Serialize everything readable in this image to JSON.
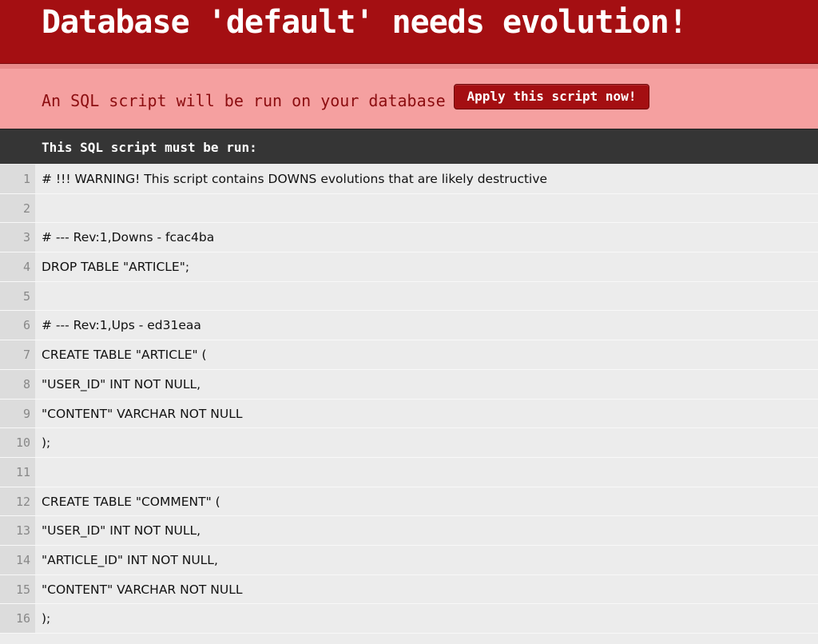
{
  "header": {
    "title": "Database 'default' needs evolution!"
  },
  "notice": {
    "text": "An SQL script will be run on your database -",
    "apply_button_label": "Apply this script now!"
  },
  "script_bar": {
    "label": "This SQL script must be run:"
  },
  "script_lines": [
    {
      "no": "1",
      "text": "# !!! WARNING! This script contains DOWNS evolutions that are likely destructive"
    },
    {
      "no": "2",
      "text": ""
    },
    {
      "no": "3",
      "text": "# --- Rev:1,Downs - fcac4ba"
    },
    {
      "no": "4",
      "text": "DROP TABLE \"ARTICLE\";"
    },
    {
      "no": "5",
      "text": ""
    },
    {
      "no": "6",
      "text": "# --- Rev:1,Ups - ed31eaa"
    },
    {
      "no": "7",
      "text": "CREATE TABLE \"ARTICLE\" ("
    },
    {
      "no": "8",
      "text": "\"USER_ID\" INT NOT NULL,"
    },
    {
      "no": "9",
      "text": "\"CONTENT\" VARCHAR NOT NULL"
    },
    {
      "no": "10",
      "text": ");"
    },
    {
      "no": "11",
      "text": ""
    },
    {
      "no": "12",
      "text": "CREATE TABLE \"COMMENT\" ("
    },
    {
      "no": "13",
      "text": "\"USER_ID\" INT NOT NULL,"
    },
    {
      "no": "14",
      "text": "\"ARTICLE_ID\" INT NOT NULL,"
    },
    {
      "no": "15",
      "text": "\"CONTENT\" VARCHAR NOT NULL"
    },
    {
      "no": "16",
      "text": ");"
    }
  ],
  "colors": {
    "header_bg": "#a40f12",
    "notice_bg": "#f5a0a0",
    "notice_text": "#8c0d10",
    "script_bar_bg": "#353535",
    "code_bg": "#ececec",
    "gutter_bg": "#dcdcdc"
  }
}
